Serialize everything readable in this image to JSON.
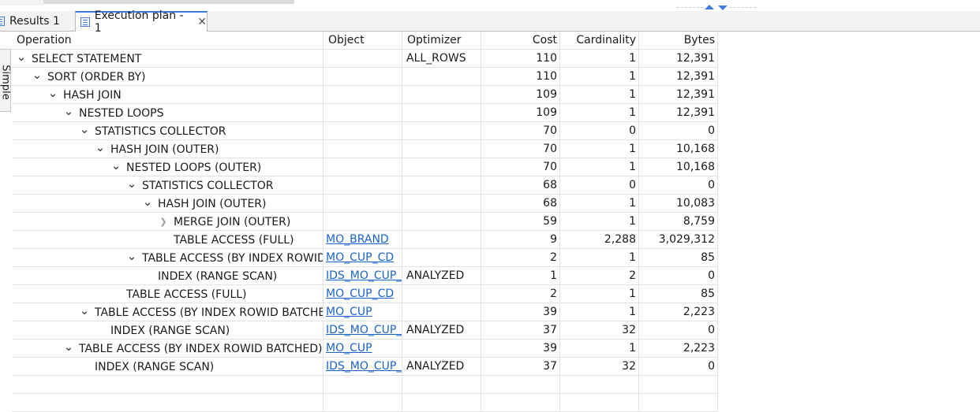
{
  "tabs": [
    {
      "label": "Results 1",
      "active": false
    },
    {
      "label": "Execution plan - 1",
      "active": true
    }
  ],
  "side_tab": {
    "label": "Simple"
  },
  "columns": {
    "operation": "Operation",
    "object": "Object",
    "optimizer": "Optimizer",
    "cost": "Cost",
    "cardinality": "Cardinality",
    "bytes": "Bytes"
  },
  "rows": [
    {
      "operation": "SELECT STATEMENT",
      "depth": 0,
      "toggle": "expanded",
      "object": "",
      "optimizer": "ALL_ROWS",
      "cost": "110",
      "cardinality": "1",
      "bytes": "12,391"
    },
    {
      "operation": "SORT (ORDER BY)",
      "depth": 1,
      "toggle": "expanded",
      "object": "",
      "optimizer": "",
      "cost": "110",
      "cardinality": "1",
      "bytes": "12,391"
    },
    {
      "operation": "HASH JOIN",
      "depth": 2,
      "toggle": "expanded",
      "object": "",
      "optimizer": "",
      "cost": "109",
      "cardinality": "1",
      "bytes": "12,391"
    },
    {
      "operation": "NESTED LOOPS",
      "depth": 3,
      "toggle": "expanded",
      "object": "",
      "optimizer": "",
      "cost": "109",
      "cardinality": "1",
      "bytes": "12,391"
    },
    {
      "operation": "STATISTICS COLLECTOR",
      "depth": 4,
      "toggle": "expanded",
      "object": "",
      "optimizer": "",
      "cost": "70",
      "cardinality": "0",
      "bytes": "0"
    },
    {
      "operation": "HASH JOIN (OUTER)",
      "depth": 5,
      "toggle": "expanded",
      "object": "",
      "optimizer": "",
      "cost": "70",
      "cardinality": "1",
      "bytes": "10,168"
    },
    {
      "operation": "NESTED LOOPS (OUTER)",
      "depth": 6,
      "toggle": "expanded",
      "object": "",
      "optimizer": "",
      "cost": "70",
      "cardinality": "1",
      "bytes": "10,168"
    },
    {
      "operation": "STATISTICS COLLECTOR",
      "depth": 7,
      "toggle": "expanded",
      "object": "",
      "optimizer": "",
      "cost": "68",
      "cardinality": "0",
      "bytes": "0"
    },
    {
      "operation": "HASH JOIN (OUTER)",
      "depth": 8,
      "toggle": "expanded",
      "object": "",
      "optimizer": "",
      "cost": "68",
      "cardinality": "1",
      "bytes": "10,083"
    },
    {
      "operation": "MERGE JOIN (OUTER)",
      "depth": 9,
      "toggle": "collapsed",
      "object": "",
      "optimizer": "",
      "cost": "59",
      "cardinality": "1",
      "bytes": "8,759"
    },
    {
      "operation": "TABLE ACCESS (FULL)",
      "depth": 9,
      "toggle": "none",
      "object": "MO_BRAND",
      "optimizer": "",
      "cost": "9",
      "cardinality": "2,288",
      "bytes": "3,029,312"
    },
    {
      "operation": "TABLE ACCESS (BY INDEX ROWID",
      "depth": 7,
      "toggle": "expanded",
      "object": "MO_CUP_CD",
      "optimizer": "",
      "cost": "2",
      "cardinality": "1",
      "bytes": "85"
    },
    {
      "operation": "INDEX (RANGE SCAN)",
      "depth": 8,
      "toggle": "none",
      "object": "IDS_MO_CUP_",
      "optimizer": "ANALYZED",
      "cost": "1",
      "cardinality": "2",
      "bytes": "0"
    },
    {
      "operation": "TABLE ACCESS (FULL)",
      "depth": 6,
      "toggle": "none",
      "object": "MO_CUP_CD",
      "optimizer": "",
      "cost": "2",
      "cardinality": "1",
      "bytes": "85"
    },
    {
      "operation": "TABLE ACCESS (BY INDEX ROWID BATCHE",
      "depth": 4,
      "toggle": "expanded",
      "object": "MO_CUP",
      "optimizer": "",
      "cost": "39",
      "cardinality": "1",
      "bytes": "2,223"
    },
    {
      "operation": "INDEX (RANGE SCAN)",
      "depth": 5,
      "toggle": "none",
      "object": "IDS_MO_CUP_",
      "optimizer": "ANALYZED",
      "cost": "37",
      "cardinality": "32",
      "bytes": "0"
    },
    {
      "operation": "TABLE ACCESS (BY INDEX ROWID BATCHED)",
      "depth": 3,
      "toggle": "expanded",
      "object": "MO_CUP",
      "optimizer": "",
      "cost": "39",
      "cardinality": "1",
      "bytes": "2,223"
    },
    {
      "operation": "INDEX (RANGE SCAN)",
      "depth": 4,
      "toggle": "none",
      "object": "IDS_MO_CUP_",
      "optimizer": "ANALYZED",
      "cost": "37",
      "cardinality": "32",
      "bytes": "0"
    }
  ],
  "colors": {
    "accent": "#3d7de0",
    "link": "#1a63c8",
    "grid_line": "#e2e2e2"
  }
}
